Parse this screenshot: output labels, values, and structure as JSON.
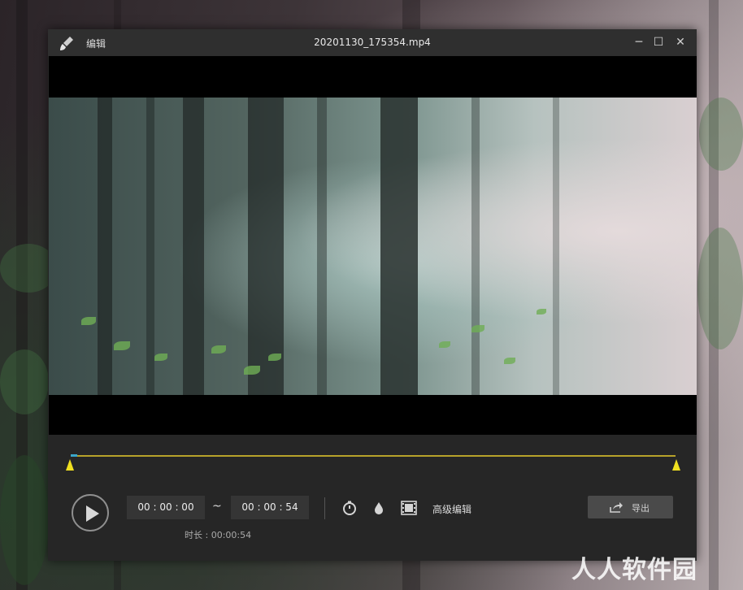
{
  "window": {
    "app_name": "编辑",
    "file_name": "20201130_175354.mp4",
    "minimize_label": "─",
    "maximize_label": "☐",
    "close_label": "✕"
  },
  "timeline": {
    "progress": 0.0
  },
  "controls": {
    "start_time": "00 : 00 : 00",
    "tilde": "~",
    "end_time": "00 : 00 : 54",
    "duration_label": "时长 : 00:00:54",
    "advanced_edit_label": "高级编辑",
    "export_label": "导出"
  },
  "icons": {
    "app": "paint-brush-icon",
    "speed": "stopwatch-icon",
    "color": "water-drop-icon",
    "film": "film-strip-icon",
    "export": "share-arrow-icon",
    "play": "play-icon"
  },
  "colors": {
    "accent_track": "#b7a22a",
    "marker": "#f0e020",
    "progress_head": "#3aa6c9"
  },
  "watermark": "人人软件园"
}
